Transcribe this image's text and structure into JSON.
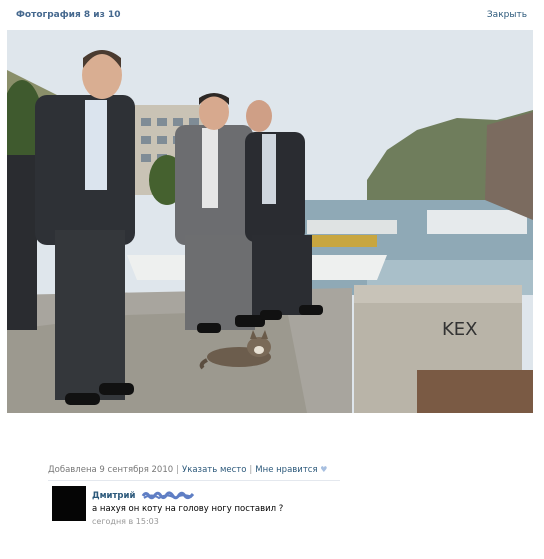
{
  "viewer": {
    "counter": "Фотография 8 из 10",
    "close_label": "Закрыть"
  },
  "photo_info": {
    "added": "Добавлена 9 сентября 2010",
    "location_link": "Указать место",
    "like_link": "Мне нравится",
    "graffiti_text": "KEX"
  },
  "comment": {
    "author_first_name": "Дмитрий",
    "text": "а нахуя он коту на голову ногу поставил ?",
    "time": "сегодня в 15:03"
  },
  "icons": {
    "like": "heart-icon",
    "avatar": "user-avatar"
  },
  "colors": {
    "link": "#2b587a",
    "title": "#45688e",
    "muted": "#777777",
    "censor": "#5f7ec4"
  }
}
